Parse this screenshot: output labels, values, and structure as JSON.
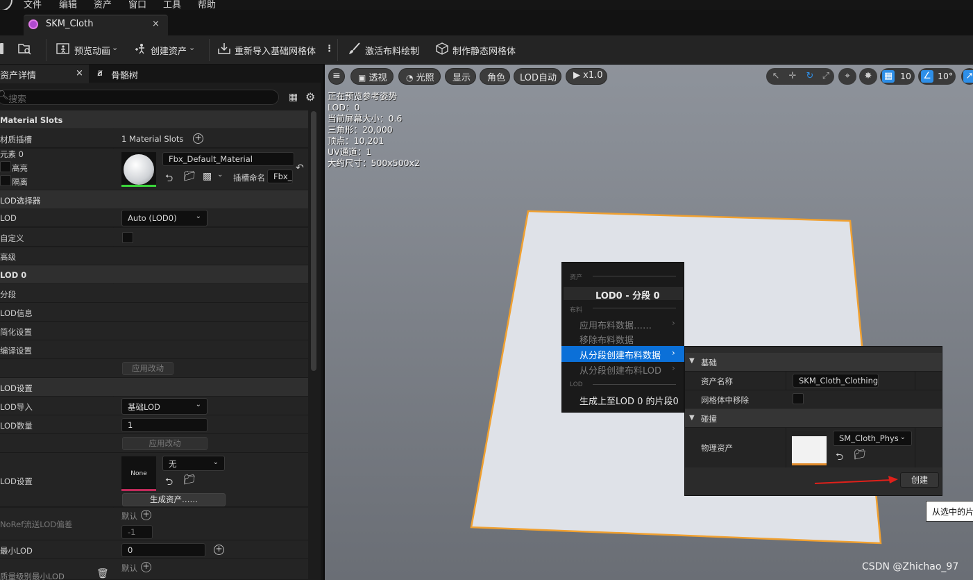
{
  "menubar": {
    "items": [
      "文件",
      "编辑",
      "资产",
      "窗口",
      "工具",
      "帮助"
    ]
  },
  "tab": {
    "title": "SKM_Cloth",
    "close": "×"
  },
  "toolbar": {
    "preview_animation": "预览动画",
    "create_asset": "创建资产",
    "reimport_base_mesh": "重新导入基础网格体",
    "activate_cloth_paint": "激活布料绘制",
    "make_static_mesh": "制作静态网格体"
  },
  "left_panel": {
    "tabs": [
      "资产详情",
      "骨骼树"
    ],
    "tab_close": "×",
    "search_placeholder": "搜索",
    "material_slots": {
      "section": "Material Slots",
      "label": "材质插槽",
      "value": "1 Material Slots",
      "element_label": "元素 0",
      "highlight": "高亮",
      "isolate": "隔离",
      "material_name": "Fbx_Default_Material",
      "slot_name_label": "插槽命名",
      "slot_name_value": "Fbx_Default_Material"
    },
    "lod_picker": {
      "section": "LOD选择器",
      "lod_label": "LOD",
      "lod_value": "Auto (LOD0)",
      "custom_label": "自定义",
      "advanced_label": "高级"
    },
    "lod0": {
      "section": "LOD 0",
      "rows": [
        "分段",
        "LOD信息",
        "简化设置",
        "编译设置"
      ],
      "apply_changes": "应用改动"
    },
    "lod_settings": {
      "section": "LOD设置",
      "lod_import_label": "LOD导入",
      "lod_import_value": "基础LOD",
      "lod_count_label": "LOD数量",
      "lod_count_value": "1",
      "apply_changes": "应用改动",
      "lod_settings_label": "LOD设置",
      "asset_thumb": "None",
      "asset_combo": "无",
      "generate_asset": "生成资产……",
      "noref_label": "NoRef流送LOD偏差",
      "default_label": "默认",
      "noref_value": "-1",
      "min_lod_label": "最小LOD",
      "min_lod_value": "0",
      "quality_min_lod_label": "质量级别最小LOD",
      "default_label2": "默认"
    }
  },
  "viewport": {
    "buttons": {
      "perspective": "透视",
      "lit": "光照",
      "show": "显示",
      "character": "角色",
      "lod_auto": "LOD自动",
      "speed": "x1.0"
    },
    "grid_snap": "10",
    "angle_snap": "10°",
    "stats": [
      "正在预览参考姿势",
      "LOD：0",
      "当前屏幕大小：0.6",
      "三角形：20,000",
      "顶点：10,201",
      "UV通道：1",
      "大约尺寸：500x500x2"
    ]
  },
  "context_menu": {
    "header_asset": "资产",
    "section_title": "LOD0 - 分段 0",
    "header_cloth": "布料",
    "apply_cloth_data": "应用布料数据……",
    "remove_cloth_data": "移除布料数据",
    "create_cloth_from_section": "从分段创建布料数据",
    "create_cloth_lod_from_section": "从分段创建布料LOD",
    "header_lod": "LOD",
    "generate_up_to_lod0": "生成上至LOD 0 的片段0"
  },
  "create_panel": {
    "basics_section": "基础",
    "asset_name_label": "资产名称",
    "asset_name_value": "SKM_Cloth_Clothing",
    "remove_from_mesh_label": "网格体中移除",
    "collision_section": "碰撞",
    "physics_asset_label": "物理资产",
    "physics_asset_value": "SM_Cloth_Phys",
    "create_button": "创建",
    "tooltip": "从选中的片"
  },
  "watermark": "CSDN @Zhichao_97",
  "colors": {
    "accent": "#0b70d8",
    "outline": "#f0a030",
    "viewport_bg": "#7c8087",
    "plane": "#dde1e8"
  }
}
